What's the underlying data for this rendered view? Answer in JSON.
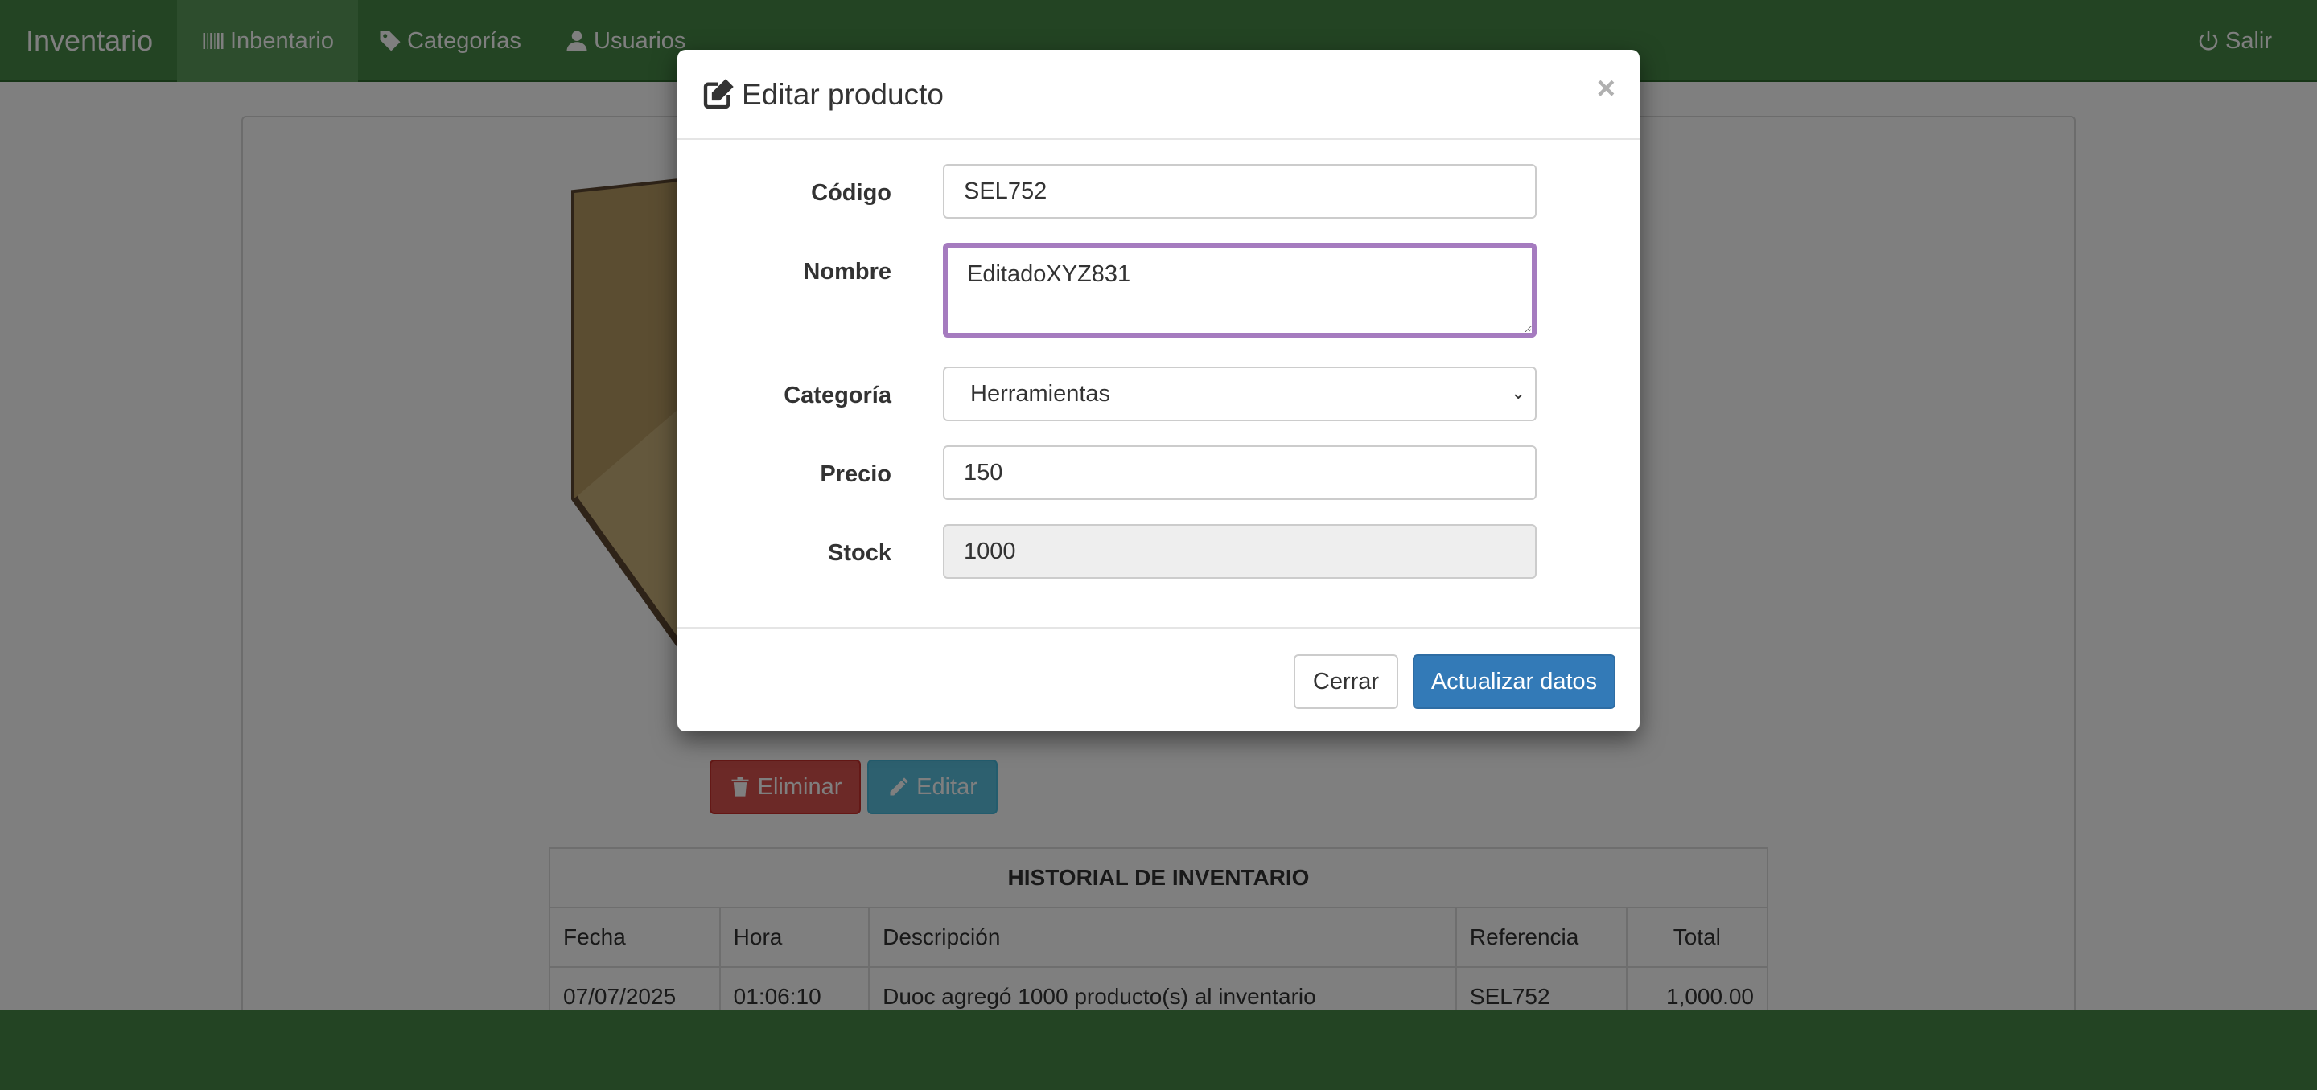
{
  "navbar": {
    "brand": "Inventario",
    "items": [
      {
        "label": "Inbentario",
        "icon": "barcode-icon"
      },
      {
        "label": "Categorías",
        "icon": "tags-icon"
      },
      {
        "label": "Usuarios",
        "icon": "user-icon"
      }
    ],
    "logout": {
      "label": "Salir",
      "icon": "power-icon"
    }
  },
  "product": {
    "delete_label": "Eliminar",
    "edit_label": "Editar"
  },
  "history": {
    "title": "HISTORIAL DE INVENTARIO",
    "columns": [
      "Fecha",
      "Hora",
      "Descripción",
      "Referencia",
      "Total"
    ],
    "rows": [
      [
        "07/07/2025",
        "01:06:10",
        "Duoc agregó 1000 producto(s) al inventario",
        "SEL752",
        "1,000.00"
      ]
    ]
  },
  "modal": {
    "title": "Editar producto",
    "close": "×",
    "fields": {
      "codigo": {
        "label": "Código",
        "value": "SEL752"
      },
      "nombre": {
        "label": "Nombre",
        "value": "EditadoXYZ831"
      },
      "categoria": {
        "label": "Categoría",
        "value": "Herramientas"
      },
      "precio": {
        "label": "Precio",
        "value": "150"
      },
      "stock": {
        "label": "Stock",
        "value": "1000"
      }
    },
    "cancel_label": "Cerrar",
    "submit_label": "Actualizar datos"
  },
  "colors": {
    "navbar": "#468847",
    "danger": "#d9534f",
    "info": "#5bc0de",
    "primary": "#337ab7",
    "focus_border": "#a57bbf"
  }
}
